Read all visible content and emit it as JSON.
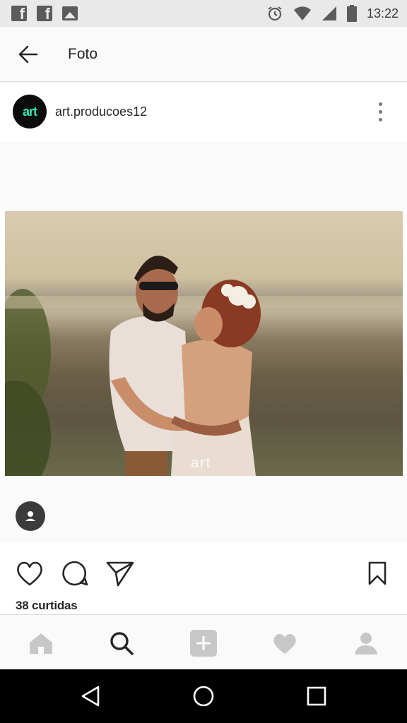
{
  "status_bar": {
    "time": "13:22",
    "left_icons": [
      "facebook-icon",
      "facebook-icon",
      "image-icon"
    ],
    "right_icons": [
      "alarm-icon",
      "wifi-icon",
      "signal-icon",
      "battery-icon"
    ]
  },
  "toolbar": {
    "back_icon": "arrow-left-icon",
    "title": "Foto"
  },
  "post": {
    "avatar_text": "art",
    "username": "art.producoes12",
    "photo_watermark": "art",
    "likes": "38 curtidas"
  },
  "actions": [
    "heart-icon",
    "comment-icon",
    "send-icon",
    "bookmark-icon"
  ],
  "bottom_nav": [
    "home-icon",
    "search-icon",
    "add-icon",
    "heart-icon",
    "profile-icon"
  ],
  "system_nav": [
    "back-triangle-icon",
    "home-circle-icon",
    "recents-square-icon"
  ],
  "colors": {
    "avatar_text": "#2ee6b8",
    "background": "#fafafa",
    "icon_dark": "#262626",
    "icon_inactive": "#c7c7c7"
  }
}
